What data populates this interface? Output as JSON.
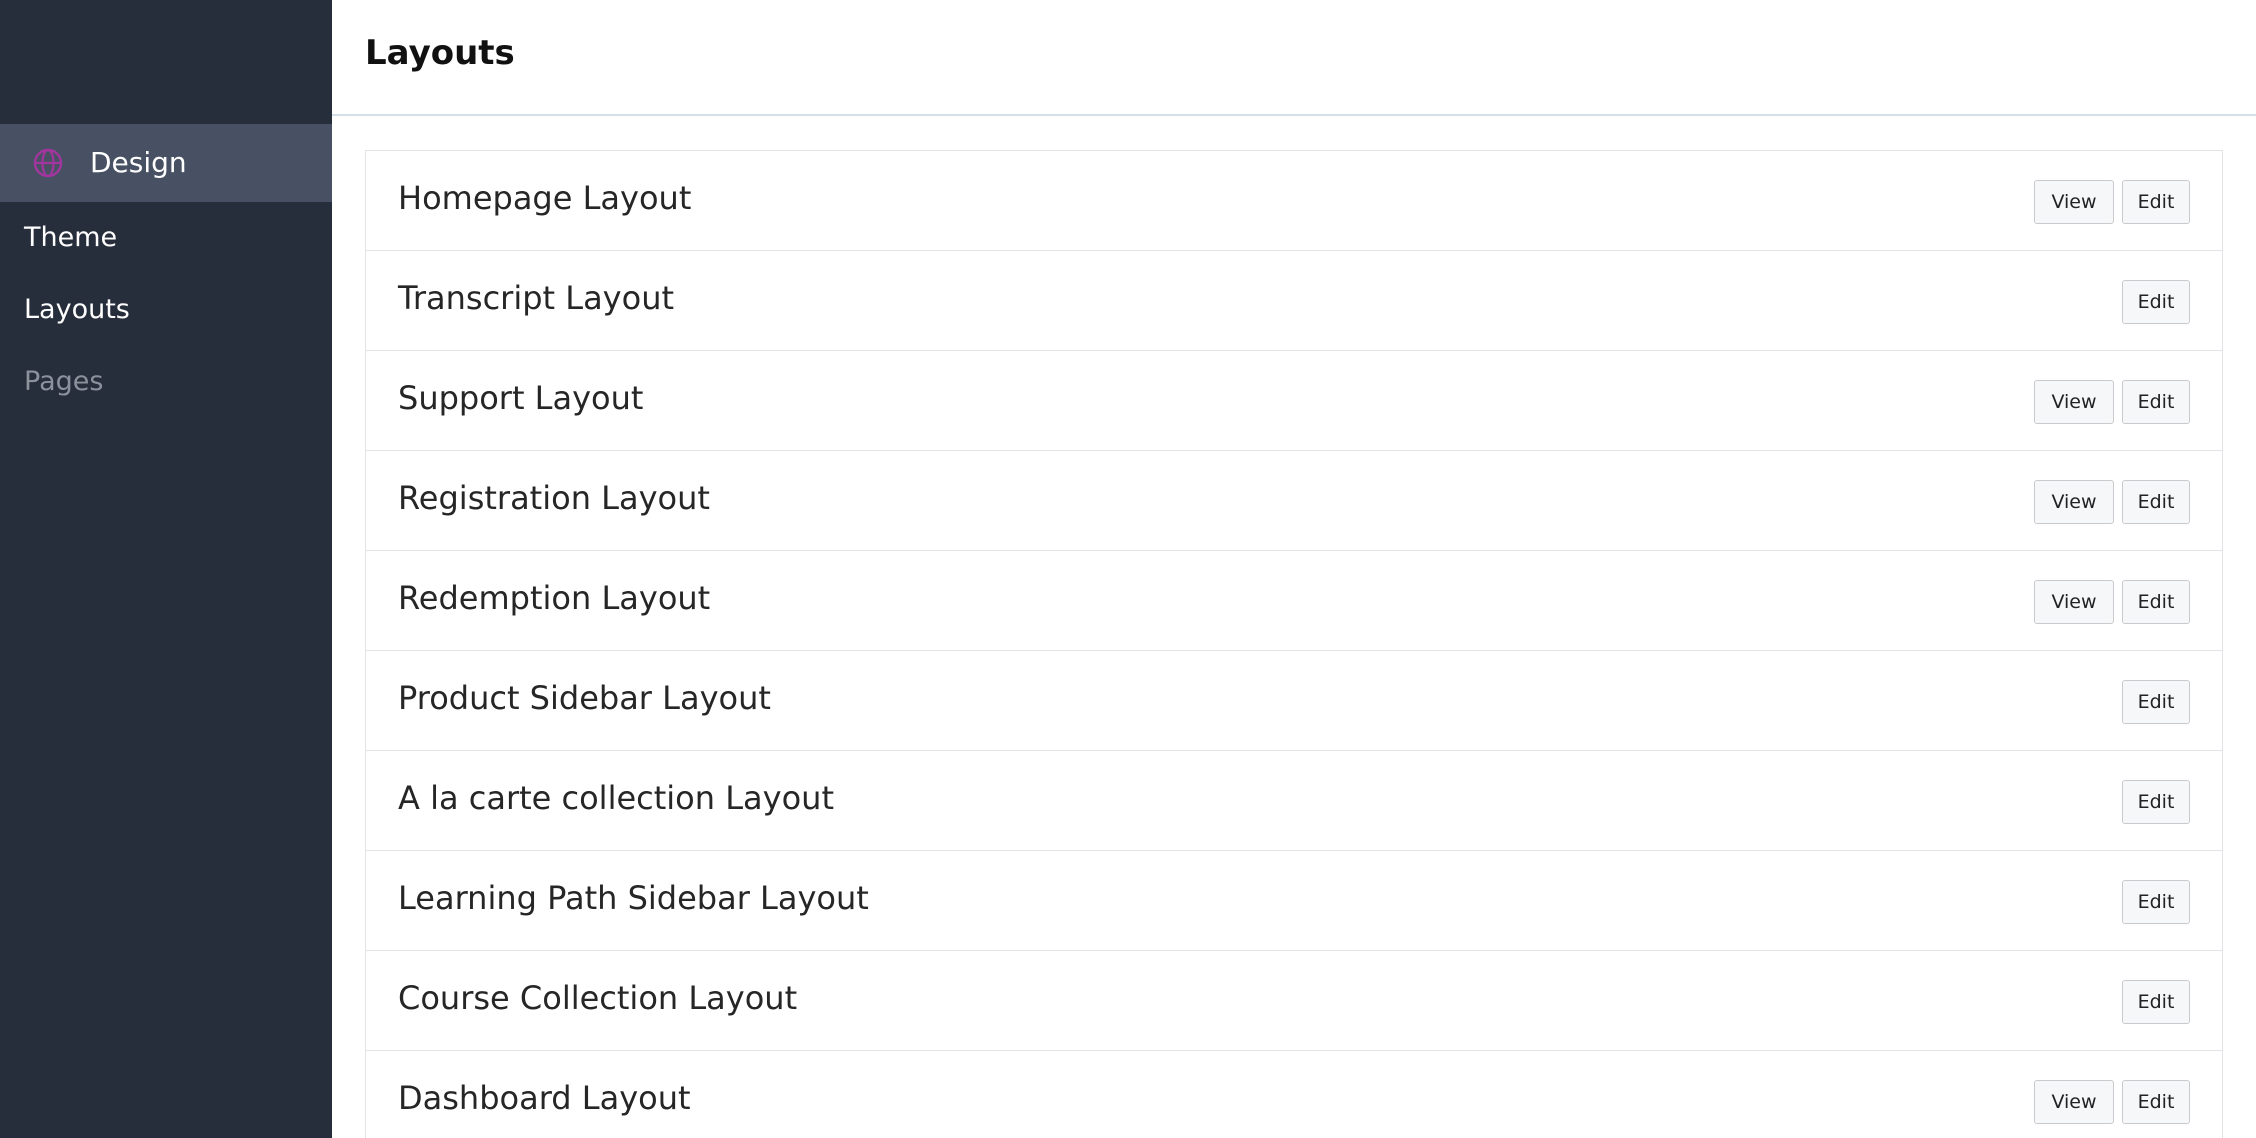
{
  "sidebar": {
    "active": {
      "label": "Design",
      "icon": "globe-icon",
      "icon_color": "#a3359e"
    },
    "items": [
      {
        "label": "Theme"
      },
      {
        "label": "Layouts"
      },
      {
        "label": "Pages"
      }
    ]
  },
  "header": {
    "title": "Layouts"
  },
  "buttons": {
    "view": "View",
    "edit": "Edit"
  },
  "layouts": [
    {
      "name": "Homepage Layout",
      "has_view": true
    },
    {
      "name": "Transcript Layout",
      "has_view": false
    },
    {
      "name": "Support Layout",
      "has_view": true
    },
    {
      "name": "Registration Layout",
      "has_view": true
    },
    {
      "name": "Redemption Layout",
      "has_view": true
    },
    {
      "name": "Product Sidebar Layout",
      "has_view": false
    },
    {
      "name": "A la carte collection Layout",
      "has_view": false
    },
    {
      "name": "Learning Path Sidebar Layout",
      "has_view": false
    },
    {
      "name": "Course Collection Layout",
      "has_view": false
    },
    {
      "name": "Dashboard Layout",
      "has_view": true
    }
  ]
}
